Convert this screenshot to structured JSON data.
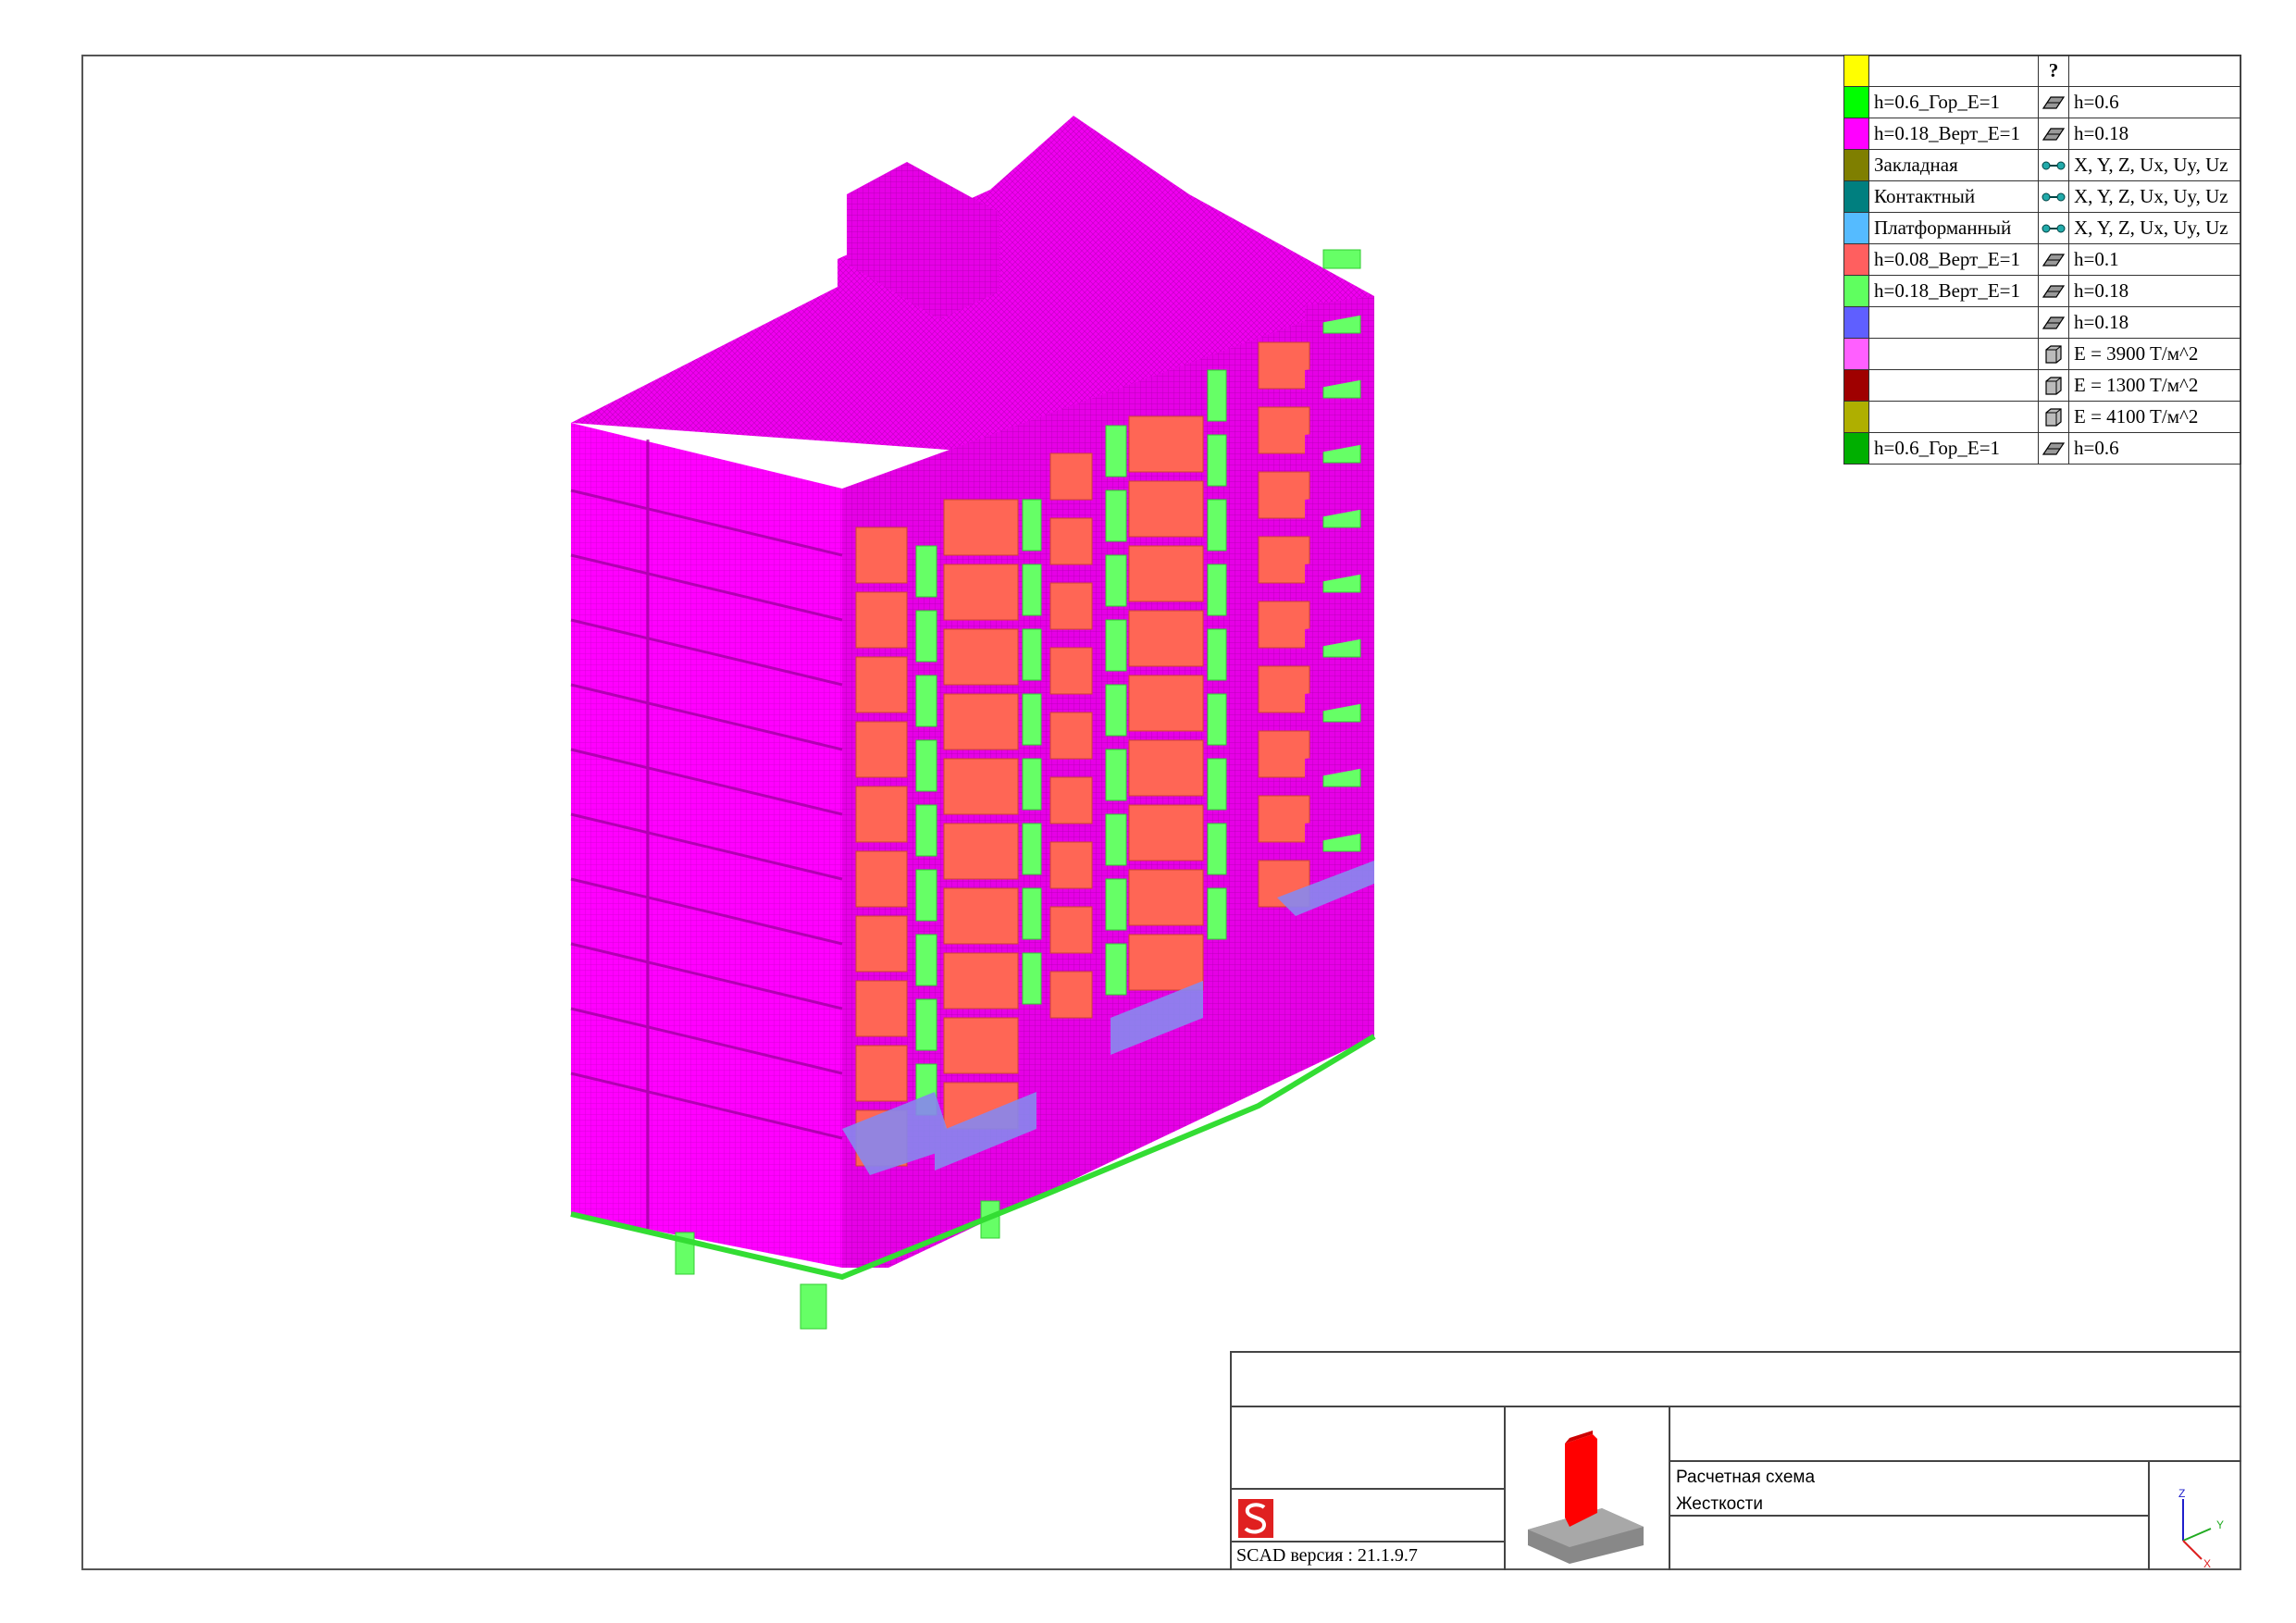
{
  "legend": {
    "header_mark": "?",
    "rows": [
      {
        "color": "#ffff00",
        "name": "",
        "icon": "question-icon",
        "value": ""
      },
      {
        "color": "#00ff00",
        "name": "h=0.6_Гор_E=1",
        "icon": "plate-icon",
        "value": "h=0.6"
      },
      {
        "color": "#ff00ff",
        "name": "h=0.18_Верт_E=1",
        "icon": "plate-icon",
        "value": "h=0.18"
      },
      {
        "color": "#7f7f00",
        "name": "Закладная",
        "icon": "link-icon",
        "value": "X, Y, Z, Ux, Uy, Uz"
      },
      {
        "color": "#007f7f",
        "name": "Контактный",
        "icon": "link-icon",
        "value": "X, Y, Z, Ux, Uy, Uz"
      },
      {
        "color": "#55bbff",
        "name": "Платформанный",
        "icon": "link-icon",
        "value": "X, Y, Z, Ux, Uy, Uz"
      },
      {
        "color": "#ff5f5f",
        "name": "h=0.08_Верт_E=1",
        "icon": "plate-icon",
        "value": "h=0.1"
      },
      {
        "color": "#5fff5f",
        "name": "h=0.18_Верт_E=1",
        "icon": "plate-icon",
        "value": "h=0.18"
      },
      {
        "color": "#5f5fff",
        "name": "",
        "icon": "plate-icon",
        "value": "h=0.18"
      },
      {
        "color": "#ff5fff",
        "name": "",
        "icon": "solid-icon",
        "value": "E = 3900 T/м^2"
      },
      {
        "color": "#9f0000",
        "name": "",
        "icon": "solid-icon",
        "value": "E = 1300 T/м^2"
      },
      {
        "color": "#afaf00",
        "name": "",
        "icon": "solid-icon",
        "value": "E = 4100 T/м^2"
      },
      {
        "color": "#00af00",
        "name": "h=0.6_Гор_E=1",
        "icon": "plate-icon",
        "value": "h=0.6"
      }
    ]
  },
  "title_block": {
    "version": "SCAD версия : 21.1.9.7",
    "line1": "Расчетная схема",
    "line2": "Жесткости"
  },
  "axes": {
    "x": "X",
    "y": "Y",
    "z": "Z"
  },
  "colors": {
    "shell": "#ff00ff",
    "balcony": "#66ff66",
    "window": "#ff6655",
    "slab_blue": "#8888ee",
    "logo_red": "#e02020",
    "preview_red": "#ff0000",
    "preview_grey": "#888888"
  }
}
